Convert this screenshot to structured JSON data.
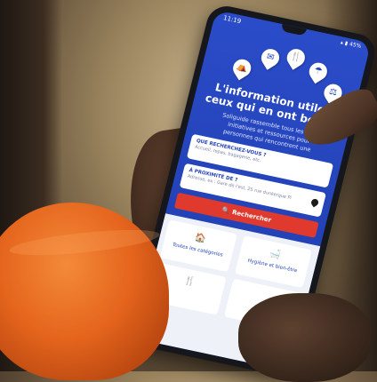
{
  "status_bar": {
    "time": "11:19",
    "icons": "▴ ▮ 45%"
  },
  "headline": "L'information utile à ceux qui en ont besoin",
  "subtext_lines": [
    "Soliguide rassemble tous les servi",
    "initiatives et ressources pour",
    "personnes qui rencontrent une"
  ],
  "search_card": {
    "label": "QUE RECHERCHEZ-VOUS ?",
    "placeholder": "Accueil, repas, bagagerie, etc."
  },
  "location_card": {
    "label": "À PROXIMITÉ DE ?",
    "placeholder": "Adresse, ex : Gare de l'est, 25 rue dunkerque Pi"
  },
  "search_button": {
    "label": "Rechercher"
  },
  "categories": [
    {
      "label": "Toutes les catégories",
      "icon": "🏠"
    },
    {
      "label": "Hygiène et bien-être",
      "icon": "🛁"
    },
    {
      "label": "",
      "icon": "🍴"
    },
    {
      "label": "",
      "icon": ""
    }
  ],
  "colors": {
    "brand_blue": "#2443b8",
    "accent_red": "#e0392e",
    "hat_orange": "#e5651d"
  }
}
